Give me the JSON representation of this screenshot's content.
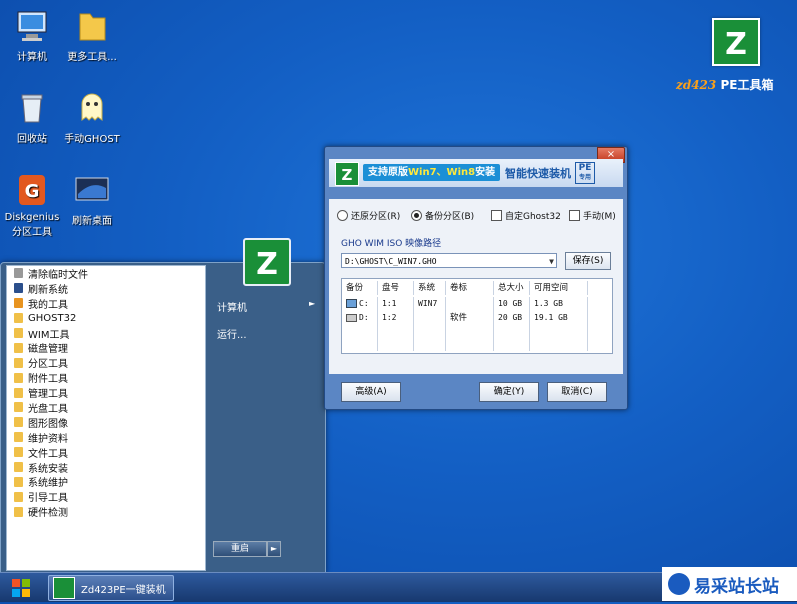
{
  "desktop": {
    "icons": [
      {
        "label": "计算机",
        "icon": "computer-icon"
      },
      {
        "label": "更多工具...",
        "icon": "folder-icon"
      },
      {
        "label": "回收站",
        "icon": "recycle-bin-icon"
      },
      {
        "label": "手动GHOST",
        "icon": "ghost-icon"
      },
      {
        "label": "Diskgenius\n分区工具",
        "icon": "diskgenius-icon"
      },
      {
        "label": "刷新桌面",
        "icon": "refresh-desktop-icon"
      }
    ],
    "brand_logo_letter": "Z",
    "brand_logo_text": "zd423",
    "brand_text": "PE工具箱"
  },
  "start_menu": {
    "items": [
      {
        "label": "清除临时文件",
        "icon": "cleanup-icon"
      },
      {
        "label": "刷新系统",
        "icon": "refresh-icon"
      },
      {
        "label": "我的工具",
        "icon": "toolbox-icon"
      },
      {
        "label": "GHOST32",
        "icon": "folder-icon"
      },
      {
        "label": "WIM工具",
        "icon": "folder-icon"
      },
      {
        "label": "磁盘管理",
        "icon": "folder-icon"
      },
      {
        "label": "分区工具",
        "icon": "folder-icon"
      },
      {
        "label": "附件工具",
        "icon": "folder-icon"
      },
      {
        "label": "管理工具",
        "icon": "folder-icon"
      },
      {
        "label": "光盘工具",
        "icon": "folder-icon"
      },
      {
        "label": "图形图像",
        "icon": "folder-icon"
      },
      {
        "label": "维护资料",
        "icon": "folder-icon"
      },
      {
        "label": "文件工具",
        "icon": "folder-icon"
      },
      {
        "label": "系统安装",
        "icon": "folder-icon"
      },
      {
        "label": "系统维护",
        "icon": "folder-icon"
      },
      {
        "label": "引导工具",
        "icon": "folder-icon"
      },
      {
        "label": "硬件检测",
        "icon": "folder-icon"
      }
    ],
    "right_links": {
      "computer": "计算机",
      "run": "运行..."
    },
    "logo_letter": "Z",
    "restart_label": "重启"
  },
  "taskbar": {
    "task_label": "Zd423PE一键装机",
    "watermark_text": "易采站长站"
  },
  "dialog": {
    "close_label": "×",
    "logo_letter": "Z",
    "slogan_prefix": "支持原版",
    "slogan_highlight": "Win7、Win8",
    "slogan_suffix": "安装",
    "product": "智能快速装机",
    "pe_badge": "PE",
    "pe_sub": "专用",
    "options": {
      "restore": "还原分区(R)",
      "backup": "备份分区(B)",
      "custom": "自定Ghost32",
      "manual": "手动(M)"
    },
    "path_label": "GHO WIM ISO 映像路径",
    "path_value": "D:\\GHOST\\C_WIN7.GHO",
    "save_label": "保存(S)",
    "table": {
      "headers": [
        "备份",
        "盘号",
        "系统",
        "卷标",
        "总大小",
        "可用空间"
      ],
      "rows": [
        {
          "drive": "C:",
          "disk": "1:1",
          "system": "WIN7",
          "label": "",
          "total": "10 GB",
          "free": "1.3 GB",
          "icon": "system-drive-icon"
        },
        {
          "drive": "D:",
          "disk": "1:2",
          "system": "",
          "label": "软件",
          "total": "20 GB",
          "free": "19.1 GB",
          "icon": "drive-icon"
        }
      ]
    },
    "buttons": {
      "advanced": "高级(A)",
      "ok": "确定(Y)",
      "cancel": "取消(C)"
    }
  }
}
